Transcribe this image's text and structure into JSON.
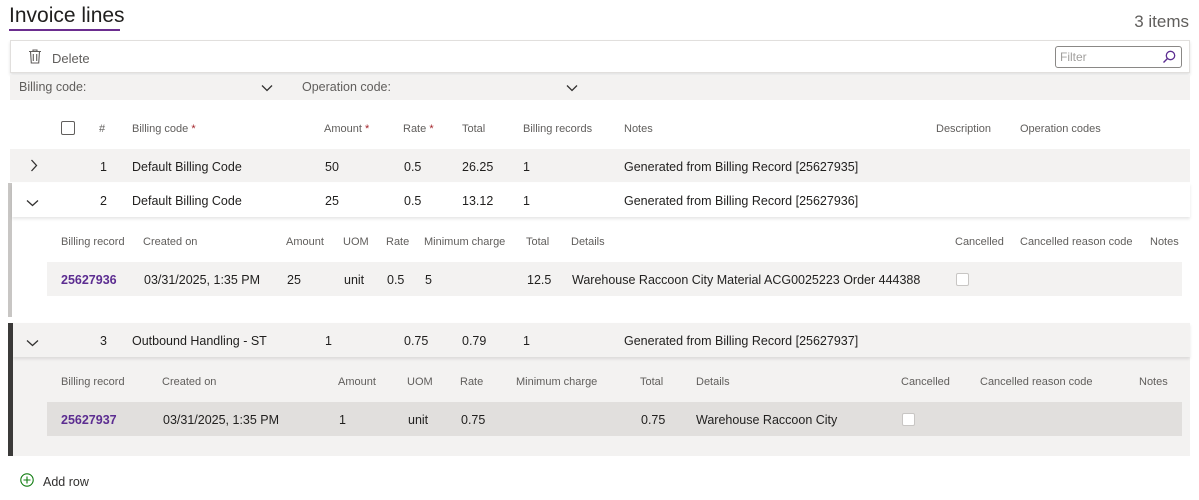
{
  "page": {
    "title": "Invoice lines",
    "item_count": "3 items"
  },
  "toolbar": {
    "delete_label": "Delete",
    "filter_placeholder": "Filter"
  },
  "grouping": {
    "billing_code_label": "Billing code:",
    "operation_code_label": "Operation code:"
  },
  "columns": {
    "number": "#",
    "billing_code": "Billing code",
    "amount": "Amount",
    "rate": "Rate",
    "total": "Total",
    "billing_records": "Billing records",
    "notes": "Notes",
    "description": "Description",
    "operation_codes": "Operation codes",
    "required_mark": "*"
  },
  "sub_columns": {
    "billing_record": "Billing record",
    "created_on": "Created on",
    "amount": "Amount",
    "uom": "UOM",
    "rate": "Rate",
    "minimum_charge": "Minimum charge",
    "total": "Total",
    "details": "Details",
    "cancelled": "Cancelled",
    "cancelled_reason_code": "Cancelled reason code",
    "notes": "Notes"
  },
  "rows": [
    {
      "number": "1",
      "billing_code": "Default Billing Code",
      "amount": "50",
      "rate": "0.5",
      "total": "26.25",
      "billing_records": "1",
      "notes": "Generated from Billing Record [25627935]",
      "expanded": false
    },
    {
      "number": "2",
      "billing_code": "Default Billing Code",
      "amount": "25",
      "rate": "0.5",
      "total": "13.12",
      "billing_records": "1",
      "notes": "Generated from Billing Record [25627936]",
      "expanded": true,
      "record": {
        "billing_record": "25627936",
        "created_on": "03/31/2025, 1:35 PM",
        "amount": "25",
        "uom": "unit",
        "rate": "0.5",
        "minimum_charge": "5",
        "total": "12.5",
        "details": "Warehouse Raccoon City Material ACG0025223 Order 444388",
        "cancelled": false
      }
    },
    {
      "number": "3",
      "billing_code": "Outbound Handling - ST",
      "amount": "1",
      "rate": "0.75",
      "total": "0.79",
      "billing_records": "1",
      "notes": "Generated from Billing Record [25627937]",
      "expanded": true,
      "record": {
        "billing_record": "25627937",
        "created_on": "03/31/2025, 1:35 PM",
        "amount": "1",
        "uom": "unit",
        "rate": "0.75",
        "minimum_charge": "",
        "total": "0.75",
        "details": "Warehouse Raccoon City",
        "cancelled": false
      }
    }
  ],
  "footer": {
    "add_row_label": "Add row"
  },
  "colors": {
    "accent": "#6b2d8f",
    "link": "#5c2d91",
    "required": "#a4262c",
    "band": "#f3f2f1"
  }
}
